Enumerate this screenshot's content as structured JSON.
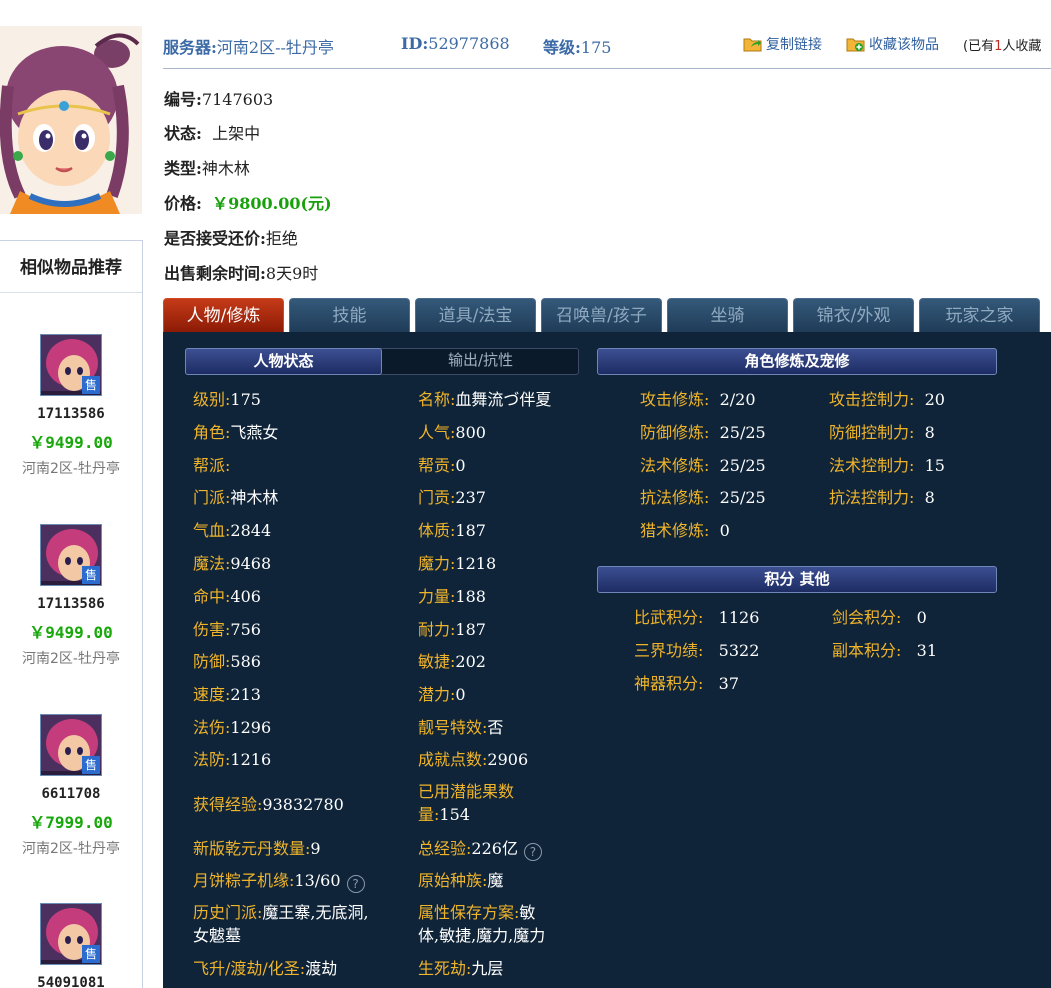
{
  "header": {
    "server_label": "服务器:",
    "server_value": "河南2区--牡丹亭",
    "id_label": "ID:",
    "id_value": "52977868",
    "level_label": "等级:",
    "level_value": "175",
    "copy_link": "复制链接",
    "favorite": "收藏该物品",
    "fav_prefix": "(已有",
    "fav_count": "1",
    "fav_suffix": "人收藏"
  },
  "info": {
    "number_label": "编号:",
    "number_value": "7147603",
    "status_label": "状态:",
    "status_value": "上架中",
    "type_label": "类型:",
    "type_value": "神木林",
    "price_label": "价格:",
    "price_value": "￥9800.00(元)",
    "bargain_label": "是否接受还价:",
    "bargain_value": "拒绝",
    "remaining_label": "出售剩余时间:",
    "remaining_value": "8天9时"
  },
  "sidebar": {
    "title": "相似物品推荐",
    "sale_tag": "售",
    "items": [
      {
        "id": "17113586",
        "price": "￥9499.00",
        "server": "河南2区-牡丹亭"
      },
      {
        "id": "17113586",
        "price": "￥9499.00",
        "server": "河南2区-牡丹亭"
      },
      {
        "id": "6611708",
        "price": "￥7999.00",
        "server": "河南2区-牡丹亭"
      },
      {
        "id": "54091081",
        "price": "",
        "server": ""
      }
    ]
  },
  "tabs": [
    "人物/修炼",
    "技能",
    "道具/法宝",
    "召唤兽/孩子",
    "坐骑",
    "锦衣/外观",
    "玩家之家"
  ],
  "panel": {
    "left_tab_active": "人物状态",
    "left_tab_other": "输出/抗性",
    "right_header": "角色修炼及宠修",
    "score_header": "积分 其他",
    "help_symbol": "?",
    "stats_col1": [
      {
        "k": "级别:",
        "v": "175"
      },
      {
        "k": "角色:",
        "v": "飞燕女"
      },
      {
        "k": "帮派:",
        "v": ""
      },
      {
        "k": "门派:",
        "v": "神木林"
      },
      {
        "k": "气血:",
        "v": "2844"
      },
      {
        "k": "魔法:",
        "v": "9468"
      },
      {
        "k": "命中:",
        "v": "406"
      },
      {
        "k": "伤害:",
        "v": "756"
      },
      {
        "k": "防御:",
        "v": "586"
      },
      {
        "k": "速度:",
        "v": "213"
      },
      {
        "k": "法伤:",
        "v": "1296"
      },
      {
        "k": "法防:",
        "v": "1216"
      }
    ],
    "stats_col2": [
      {
        "k": "名称:",
        "v": "血舞流づ伴夏"
      },
      {
        "k": "人气:",
        "v": "800"
      },
      {
        "k": "帮贡:",
        "v": "0"
      },
      {
        "k": "门贡:",
        "v": "237"
      },
      {
        "k": "体质:",
        "v": "187"
      },
      {
        "k": "魔力:",
        "v": "1218"
      },
      {
        "k": "力量:",
        "v": "188"
      },
      {
        "k": "耐力:",
        "v": "187"
      },
      {
        "k": "敏捷:",
        "v": "202"
      },
      {
        "k": "潜力:",
        "v": "0"
      },
      {
        "k": "靓号特效:",
        "v": "否"
      },
      {
        "k": "成就点数:",
        "v": "2906"
      }
    ],
    "exp_label": "获得经验:",
    "exp_value": "93832780",
    "potion_label_1": "已用潜能果数",
    "potion_label_2": "量:",
    "potion_value": "154",
    "qianyuan_label": "新版乾元丹数量:",
    "qianyuan_value": "9",
    "total_exp_label": "总经验:",
    "total_exp_value": "226亿",
    "mooncake_label": "月饼粽子机缘:",
    "mooncake_value": "13/60",
    "race_label": "原始种族:",
    "race_value": "魔",
    "history_label": "历史门派:",
    "history_value_1": "魔王寨,无底洞,",
    "history_value_2": "女魃墓",
    "attr_label": "属性保存方案:",
    "attr_value_1": "敏",
    "attr_value_2": "体,敏捷,魔力,魔力",
    "fly_label": "飞升/渡劫/化圣:",
    "fly_value": "渡劫",
    "life_label": "生死劫:",
    "life_value": "九层",
    "cultivation": [
      {
        "k": "攻击修炼:",
        "v": "2/20",
        "k2": "攻击控制力:",
        "v2": "20"
      },
      {
        "k": "防御修炼:",
        "v": "25/25",
        "k2": "防御控制力:",
        "v2": "8"
      },
      {
        "k": "法术修炼:",
        "v": "25/25",
        "k2": "法术控制力:",
        "v2": "15"
      },
      {
        "k": "抗法修炼:",
        "v": "25/25",
        "k2": "抗法控制力:",
        "v2": "8"
      },
      {
        "k": "猎术修炼:",
        "v": "0",
        "k2": "",
        "v2": ""
      }
    ],
    "scores": [
      {
        "k": "比武积分:",
        "v": "1126",
        "k2": "剑会积分:",
        "v2": "0"
      },
      {
        "k": "三界功绩:",
        "v": "5322",
        "k2": "副本积分:",
        "v2": "31"
      },
      {
        "k": "神器积分:",
        "v": "37",
        "k2": "",
        "v2": ""
      }
    ]
  },
  "colors": {
    "panel_bg": "#0f2438",
    "label_gold": "#f0b42a",
    "price_green": "#17a00b",
    "link_blue": "#3b6aa6",
    "active_tab_red": "#c53a18"
  }
}
